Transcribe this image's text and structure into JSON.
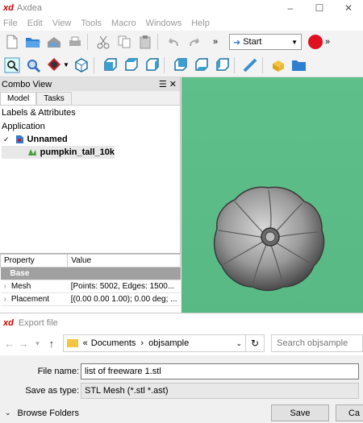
{
  "app": {
    "logo": "xd",
    "title": "Axdea"
  },
  "menu": [
    "File",
    "Edit",
    "View",
    "Tools",
    "Macro",
    "Windows",
    "Help"
  ],
  "toolbar": {
    "workbench_value": "Start",
    "overflow": "»"
  },
  "combo": {
    "header": "Combo View",
    "tabs": [
      "Model",
      "Tasks"
    ],
    "section_label": "Labels & Attributes",
    "tree": {
      "root": "Application",
      "document": "Unnamed",
      "object": "pumpkin_tall_10k"
    },
    "properties": {
      "col_property": "Property",
      "col_value": "Value",
      "group": "Base",
      "rows": [
        {
          "name": "Mesh",
          "value": "[Points: 5002, Edges: 1500..."
        },
        {
          "name": "Placement",
          "value": "[(0.00 0.00 1.00); 0.00 deg; ..."
        }
      ]
    }
  },
  "dialog": {
    "title": "Export file",
    "breadcrumb": [
      "«",
      "Documents",
      "objsample"
    ],
    "search_placeholder": "Search objsample",
    "file_name_label": "File name:",
    "file_name_value": "list of freeware 1.stl",
    "save_type_label": "Save as type:",
    "save_type_value": "STL Mesh (*.stl *.ast)",
    "browse_folders": "Browse Folders",
    "save_button": "Save",
    "cancel_button": "Ca"
  },
  "colors": {
    "viewport_bg": "#5fbf8a",
    "accent_red": "#e01020",
    "folder": "#f5c542"
  }
}
